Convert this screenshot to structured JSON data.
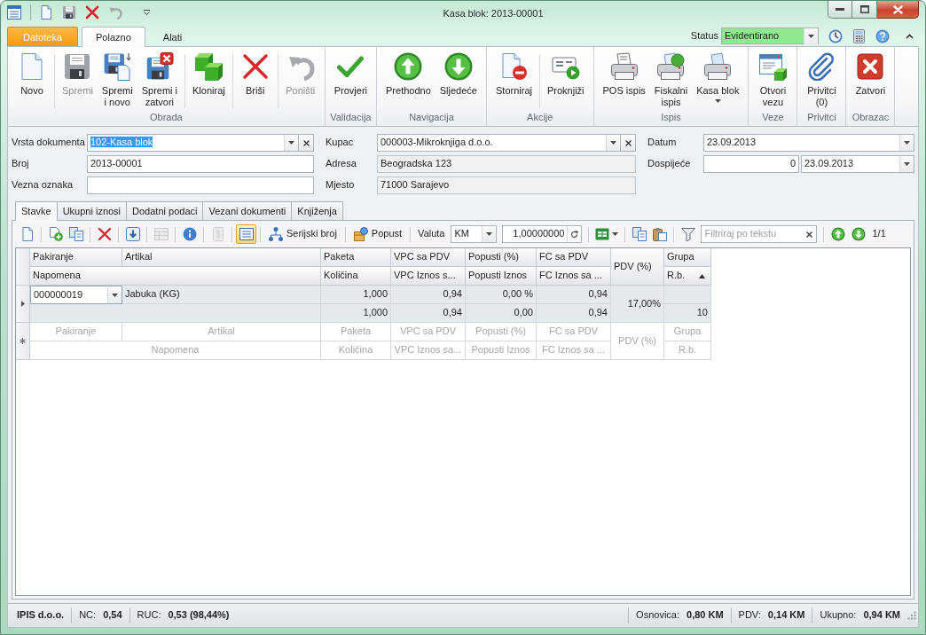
{
  "window": {
    "title": "Kasa blok: 2013-00001"
  },
  "ribbon_tabs": [
    {
      "label": "Datoteka",
      "kind": "file",
      "selected": false
    },
    {
      "label": "Polazno",
      "kind": "tab",
      "selected": true
    },
    {
      "label": "Alati",
      "kind": "tab",
      "selected": false
    }
  ],
  "status": {
    "label": "Status",
    "value": "Evidentirano"
  },
  "ribbon": {
    "groups": [
      {
        "label": "Obrada",
        "clusters": [
          [
            {
              "label": "Novo",
              "disabled": false
            }
          ],
          [
            {
              "label": "Spremi",
              "disabled": true
            },
            {
              "label": "Spremi\ni novo",
              "disabled": false
            },
            {
              "label": "Spremi i\nzatvori",
              "disabled": false
            }
          ],
          [
            {
              "label": "Kloniraj",
              "disabled": false
            }
          ],
          [
            {
              "label": "Briši",
              "disabled": false
            }
          ],
          [
            {
              "label": "Poništi",
              "disabled": true
            }
          ]
        ]
      },
      {
        "label": "Validacija",
        "clusters": [
          [
            {
              "label": "Provjeri",
              "disabled": false
            }
          ]
        ]
      },
      {
        "label": "Navigacija",
        "clusters": [
          [
            {
              "label": "Prethodno",
              "disabled": false
            },
            {
              "label": "Sljedeće",
              "disabled": false
            }
          ]
        ]
      },
      {
        "label": "Akcije",
        "clusters": [
          [
            {
              "label": "Storniraj",
              "disabled": false
            }
          ],
          [
            {
              "label": "Proknjiži",
              "disabled": false
            }
          ]
        ]
      },
      {
        "label": "Ispis",
        "clusters": [
          [
            {
              "label": "POS ispis",
              "disabled": false
            },
            {
              "label": "Fiskalni\nispis",
              "disabled": false
            },
            {
              "label": "Kasa blok",
              "disabled": false,
              "dropdown": true
            }
          ]
        ]
      },
      {
        "label": "Veze",
        "clusters": [
          [
            {
              "label": "Otvori\nvezu",
              "disabled": false
            }
          ]
        ]
      },
      {
        "label": "Privitci",
        "clusters": [
          [
            {
              "label": "Privitci\n(0)",
              "disabled": false
            }
          ]
        ]
      },
      {
        "label": "Obrazac",
        "clusters": [
          [
            {
              "label": "Zatvori",
              "disabled": false
            }
          ]
        ]
      }
    ]
  },
  "form": {
    "columns": [
      [
        {
          "label": "Vrsta dokumenta",
          "kind": "combo",
          "value": "102-Kasa blok",
          "text_selected": true
        },
        {
          "label": "Broj",
          "kind": "text",
          "value": "2013-00001"
        },
        {
          "label": "Vezna oznaka",
          "kind": "text"
        }
      ],
      [
        {
          "label": "Kupac",
          "kind": "combo",
          "value": "000003-Mikroknjiga d.o.o."
        },
        {
          "label": "Adresa",
          "kind": "readonly",
          "value": "Beogradska 123"
        },
        {
          "label": "Mjesto",
          "kind": "readonly",
          "value": "71000 Sarajevo"
        }
      ],
      [
        {
          "label": "Datum",
          "kind": "date",
          "value": "23.09.2013"
        },
        {
          "label": "Dospijeće",
          "kind": "days_date",
          "days": "0",
          "value": "23.09.2013"
        }
      ]
    ]
  },
  "document_tabs": [
    {
      "label": "Stavke",
      "selected": true
    },
    {
      "label": "Ukupni iznosi",
      "selected": false
    },
    {
      "label": "Dodatni podaci",
      "selected": false
    },
    {
      "label": "Vezani dokumenti",
      "selected": false
    },
    {
      "label": "Knjiženja",
      "selected": false
    }
  ],
  "toolbar": [
    {
      "kind": "icon",
      "disabled": false
    },
    {
      "kind": "separator"
    },
    {
      "kind": "icon",
      "disabled": false
    },
    {
      "kind": "icon",
      "disabled": false
    },
    {
      "kind": "separator"
    },
    {
      "kind": "icon",
      "disabled": false
    },
    {
      "kind": "separator"
    },
    {
      "kind": "icon",
      "disabled": false
    },
    {
      "kind": "separator"
    },
    {
      "kind": "icon",
      "disabled": true
    },
    {
      "kind": "separator"
    },
    {
      "kind": "icon",
      "disabled": false
    },
    {
      "kind": "separator"
    },
    {
      "kind": "icon",
      "disabled": true
    },
    {
      "kind": "separator"
    },
    {
      "kind": "icon",
      "disabled": false,
      "selected": true
    },
    {
      "kind": "separator"
    },
    {
      "kind": "button",
      "label": "Serijski broj"
    },
    {
      "kind": "separator"
    },
    {
      "kind": "button",
      "label": "Popust"
    },
    {
      "kind": "separator"
    },
    {
      "kind": "label",
      "label": "Valuta"
    },
    {
      "kind": "select",
      "value": "KM"
    },
    {
      "kind": "number",
      "value": "1,00000000"
    },
    {
      "kind": "separator"
    },
    {
      "kind": "icon",
      "disabled": false,
      "dropdown": true
    },
    {
      "kind": "separator"
    },
    {
      "kind": "icon",
      "disabled": false
    },
    {
      "kind": "icon",
      "disabled": false
    },
    {
      "kind": "separator"
    },
    {
      "kind": "icon",
      "disabled": false
    },
    {
      "kind": "search",
      "placeholder": "Filtriraj po tekstu"
    },
    {
      "kind": "separator"
    },
    {
      "kind": "icon",
      "disabled": false
    },
    {
      "kind": "icon",
      "disabled": false
    },
    {
      "kind": "counter",
      "label": "1/1"
    }
  ],
  "grid": {
    "header_top": [
      {
        "label": "Pakiranje"
      },
      {
        "label": "Artikal"
      },
      {
        "label": "Paketa"
      },
      {
        "label": "VPC sa PDV"
      },
      {
        "label": "Popusti (%)"
      },
      {
        "label": "FC sa PDV"
      },
      {
        "label": "PDV (%)"
      },
      {
        "label": "Grupa"
      }
    ],
    "header_bottom": [
      {
        "label": "Napomena"
      },
      {
        "label": "Količina"
      },
      {
        "label": "VPC Iznos s..."
      },
      {
        "label": "Popusti Iznos"
      },
      {
        "label": "FC Iznos sa ..."
      },
      {
        "label": "R.b.",
        "sort_ascending": true
      }
    ],
    "rows": [
      {
        "selected": true,
        "editing": true,
        "pakiranje": "000000019",
        "artikal": "Jabuka (KG)",
        "paketa": "1,000",
        "vpc_sa_pdv": "0,94",
        "popusti": "0,00 %",
        "fc_sa_pdv": "0,94",
        "pdv": "17,00%",
        "kolicina": "1,000",
        "vpc_iznos": "0,94",
        "popusti_iznos": "0,00",
        "fc_iznos": "0,94",
        "rb": "10"
      }
    ],
    "new_row": {
      "top": [
        "Pakiranje",
        "Artikal",
        "Paketa",
        "VPC sa PDV",
        "Popusti (%)",
        "FC sa PDV",
        "PDV (%)",
        "Grupa"
      ],
      "bottom": [
        "Napomena",
        "Količina",
        "VPC Iznos sa...",
        "Popusti Iznos",
        "FC Iznos sa ...",
        "R.b."
      ]
    }
  },
  "status_bar": {
    "left": [
      {
        "value": "IPIS d.o.o."
      },
      {
        "label": "NC:",
        "value": "0,54"
      },
      {
        "label": "RUC:",
        "value": "0,53 (98,44%)"
      }
    ],
    "right": [
      {
        "label": "Osnovica:",
        "value": "0,80 KM"
      },
      {
        "label": "PDV:",
        "value": "0,14 KM"
      },
      {
        "label": "Ukupno:",
        "value": "0,94 KM"
      }
    ]
  }
}
